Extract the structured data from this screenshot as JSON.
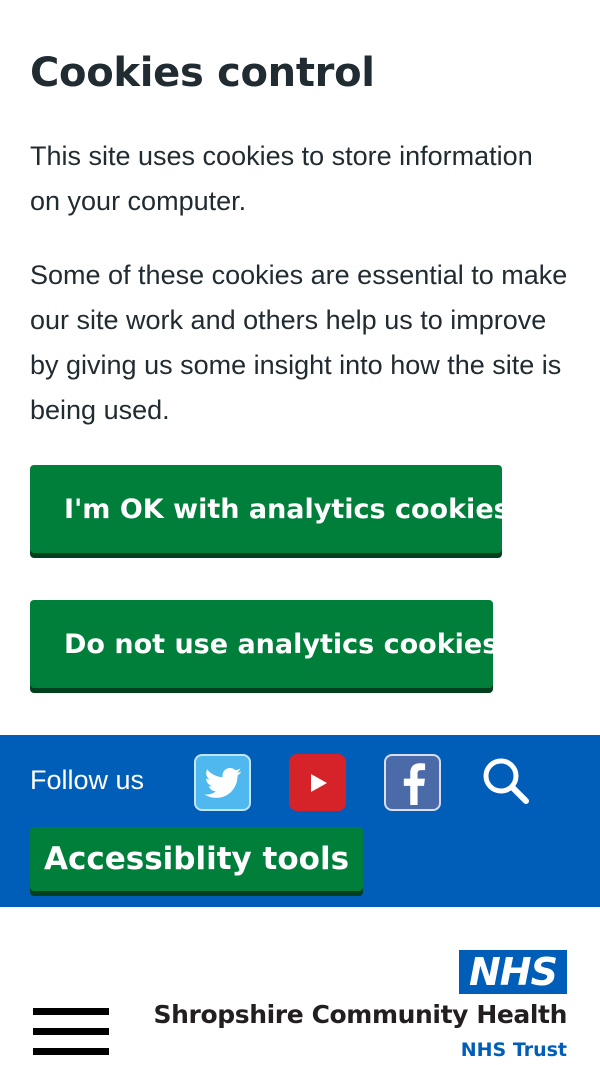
{
  "cookies": {
    "title": "Cookies control",
    "paragraph1": "This site uses cookies to store information on your computer.",
    "paragraph2": "Some of these cookies are essential to make our site work and others help us to improve by giving us some insight into how the site is being used.",
    "accept_label": "I'm OK with analytics cookies",
    "reject_label": "Do not use analytics cookies"
  },
  "social": {
    "follow_label": "Follow us",
    "icons": [
      "twitter-icon",
      "youtube-icon",
      "facebook-icon",
      "search-icon"
    ],
    "accessibility_label": "Accessiblity tools"
  },
  "header": {
    "logo_text": "NHS",
    "org_name": "Shropshire Community Health",
    "org_sub": "NHS Trust"
  },
  "colors": {
    "nhs_blue": "#005eb8",
    "button_green": "#007f3b",
    "button_shadow": "#00401e",
    "text_dark": "#212b32"
  }
}
